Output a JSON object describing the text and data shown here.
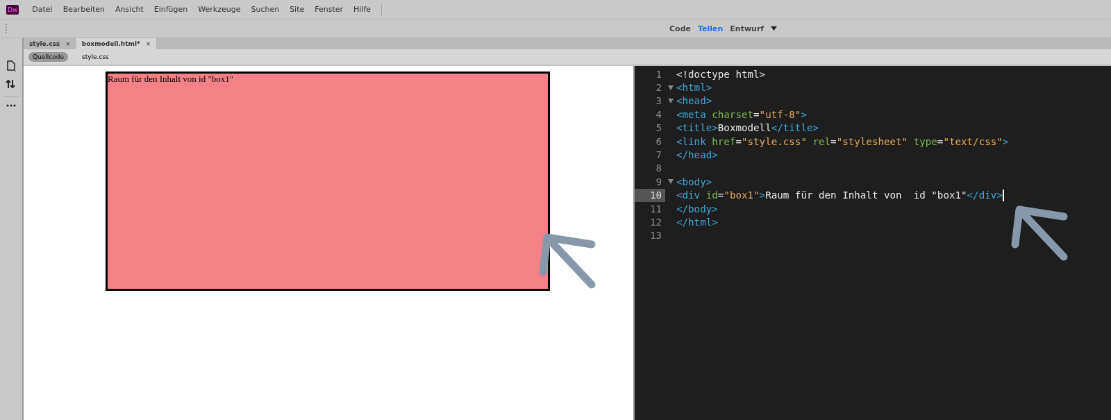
{
  "app": {
    "logo": "Dw"
  },
  "menu": [
    "Datei",
    "Bearbeiten",
    "Ansicht",
    "Einfügen",
    "Werkzeuge",
    "Suchen",
    "Site",
    "Fenster",
    "Hilfe"
  ],
  "views": [
    {
      "label": "Code",
      "selected": false
    },
    {
      "label": "Tellen",
      "selected": true
    },
    {
      "label": "Entwurf",
      "selected": false
    }
  ],
  "tabs": [
    {
      "label": "style.css",
      "close": "×",
      "selected": false
    },
    {
      "label": "boxmodell.html*",
      "close": "×",
      "selected": true
    }
  ],
  "related_files": [
    {
      "label": "Quellcode",
      "selected": true
    },
    {
      "label": "style.css",
      "selected": false
    }
  ],
  "design_view": {
    "box_text": "Raum für den Inhalt von id \"box1\""
  },
  "code_lines": [
    {
      "number": "1",
      "foldable": false,
      "selected": false,
      "tokens": [
        {
          "kind": "text",
          "text": "<!doctype html>"
        }
      ]
    },
    {
      "number": "2",
      "foldable": true,
      "selected": false,
      "tokens": [
        {
          "kind": "tag",
          "text": "<html>"
        }
      ]
    },
    {
      "number": "3",
      "foldable": true,
      "selected": false,
      "tokens": [
        {
          "kind": "tag",
          "text": "<head>"
        }
      ]
    },
    {
      "number": "4",
      "foldable": false,
      "selected": false,
      "tokens": [
        {
          "kind": "tag",
          "text": "<meta "
        },
        {
          "kind": "attr",
          "text": "charset"
        },
        {
          "kind": "text",
          "text": "="
        },
        {
          "kind": "string",
          "text": "\"utf-8\""
        },
        {
          "kind": "tag",
          "text": ">"
        }
      ]
    },
    {
      "number": "5",
      "foldable": false,
      "selected": false,
      "tokens": [
        {
          "kind": "tag",
          "text": "<title>"
        },
        {
          "kind": "text",
          "text": "Boxmodell"
        },
        {
          "kind": "tag",
          "text": "</title>"
        }
      ]
    },
    {
      "number": "6",
      "foldable": false,
      "selected": false,
      "tokens": [
        {
          "kind": "tag",
          "text": "<link "
        },
        {
          "kind": "attr",
          "text": "href"
        },
        {
          "kind": "text",
          "text": "="
        },
        {
          "kind": "string",
          "text": "\"style.css\" "
        },
        {
          "kind": "attr",
          "text": "rel"
        },
        {
          "kind": "text",
          "text": "="
        },
        {
          "kind": "string",
          "text": "\"stylesheet\" "
        },
        {
          "kind": "attr",
          "text": "type"
        },
        {
          "kind": "text",
          "text": "="
        },
        {
          "kind": "string",
          "text": "\"text/css\""
        },
        {
          "kind": "tag",
          "text": ">"
        }
      ]
    },
    {
      "number": "7",
      "foldable": false,
      "selected": false,
      "tokens": [
        {
          "kind": "tag",
          "text": "</head>"
        }
      ]
    },
    {
      "number": "8",
      "foldable": false,
      "selected": false
    },
    {
      "number": "9",
      "foldable": true,
      "selected": false,
      "tokens": [
        {
          "kind": "tag",
          "text": "<body>"
        }
      ]
    },
    {
      "number": "10",
      "foldable": false,
      "selected": true,
      "tokens": [
        {
          "kind": "tag",
          "text": "<div "
        },
        {
          "kind": "attr",
          "text": "id"
        },
        {
          "kind": "text",
          "text": "="
        },
        {
          "kind": "string",
          "text": "\"box1\""
        },
        {
          "kind": "tag",
          "text": ">"
        },
        {
          "kind": "text",
          "text": "Raum für den Inhalt von  id \"box1\""
        },
        {
          "kind": "tag",
          "text": "</div>"
        }
      ]
    },
    {
      "number": "11",
      "foldable": false,
      "selected": false,
      "tokens": [
        {
          "kind": "tag",
          "text": "</body>"
        }
      ]
    },
    {
      "number": "12",
      "foldable": false,
      "selected": false,
      "tokens": [
        {
          "kind": "tag",
          "text": "</html>"
        }
      ]
    },
    {
      "number": "13",
      "foldable": false,
      "selected": false
    }
  ]
}
